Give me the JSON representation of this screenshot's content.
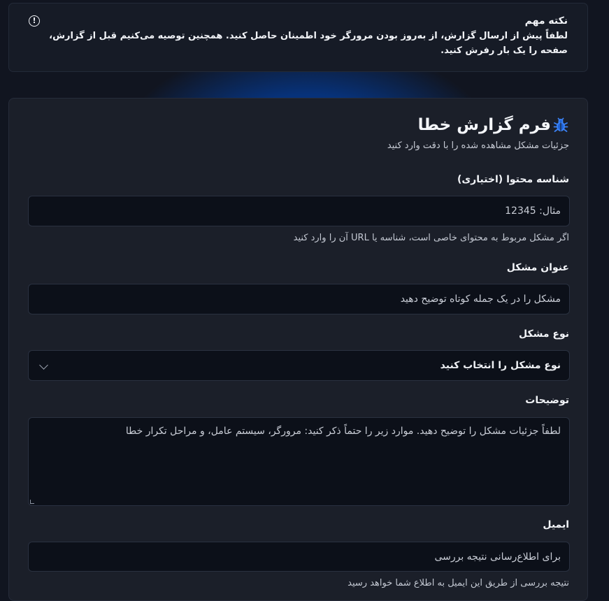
{
  "notice": {
    "title": "نکته مهم",
    "body": "لطفاً پیش از ارسال گزارش، از به‌روز بودن مرورگر خود اطمینان حاصل کنید. همچنین توصیه می‌کنیم قبل از گزارش، صفحه را یک بار رفرش کنید.",
    "icon": "info-icon"
  },
  "form": {
    "title": "فرم گزارش خطا",
    "title_icon": "bug-icon",
    "subtitle": "جزئیات مشکل مشاهده شده را با دقت وارد کنید",
    "content_id": {
      "label": "شناسه محتوا (اختیاری)",
      "placeholder": "مثال: 12345",
      "hint": "اگر مشکل مربوط به محتوای خاصی است، شناسه یا URL آن را وارد کنید"
    },
    "issue_title": {
      "label": "عنوان مشکل",
      "placeholder": "مشکل را در یک جمله کوتاه توضیح دهید"
    },
    "issue_type": {
      "label": "نوع مشکل",
      "selected": "نوع مشکل را انتخاب کنید",
      "icon": "chevron-down-icon"
    },
    "description": {
      "label": "توضیحات",
      "placeholder": "لطفاً جزئیات مشکل را توضیح دهید. موارد زیر را حتماً ذکر کنید: مرورگر، سیستم عامل، و مراحل تکرار خطا"
    },
    "email": {
      "label": "ایمیل",
      "placeholder": "برای اطلاع‌رسانی نتیجه بررسی",
      "hint": "نتیجه بررسی از طریق این ایمیل به اطلاع شما خواهد رسید"
    }
  },
  "colors": {
    "background": "#111520",
    "card": "#1b1f29",
    "input": "#0c1019",
    "accent": "#3b82f6"
  }
}
